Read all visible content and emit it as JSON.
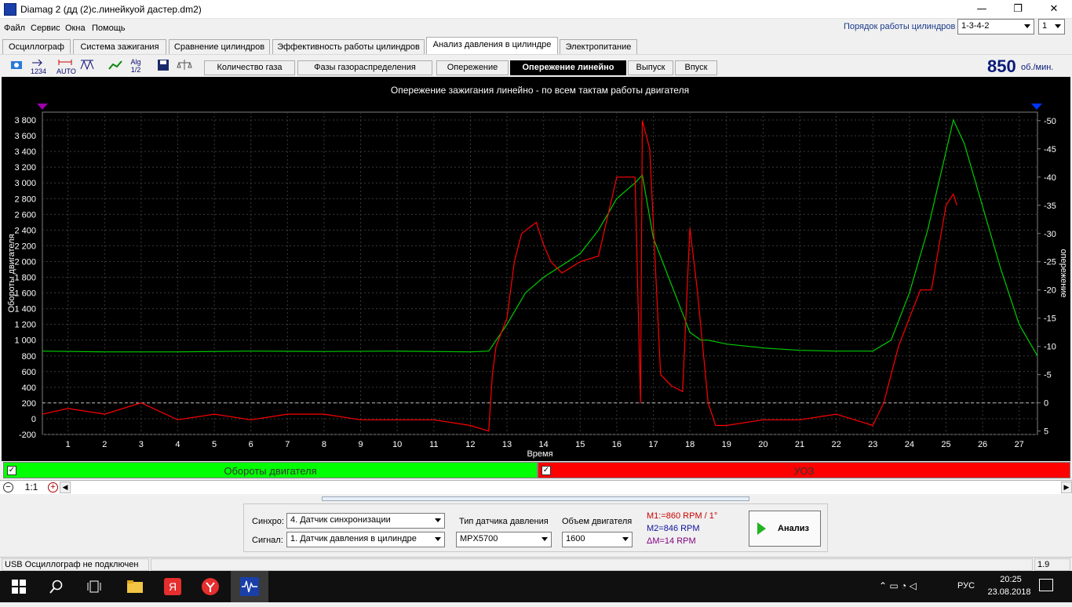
{
  "window": {
    "title": "Diamag 2 (дд (2)с.линейкуой дастер.dm2)",
    "minimize": "—",
    "maximize": "❐",
    "close": "✕"
  },
  "menu": [
    "Файл",
    "Сервис",
    "Окна",
    "Помощь"
  ],
  "cylinder_order": {
    "label": "Порядок работы цилиндров",
    "value": "1-3-4-2",
    "spinner": "1"
  },
  "main_tabs": [
    "Осциллограф",
    "Система зажигания",
    "Сравнение цилиндров",
    "Эффективность работы цилиндров",
    "Анализ давления в цилиндре",
    "Электропитание"
  ],
  "main_tab_active": "Анализ давления в цилиндре",
  "toolbar_icons": [
    "marker-icon",
    "number-icon",
    "auto-icon",
    "scale-icon",
    "graph-icon",
    "algorithm-icon",
    "save-icon",
    "balance-icon"
  ],
  "toolbar_icon_labels": [
    "",
    "1234",
    "AUTO",
    "",
    "",
    "Alg 1/2",
    "",
    ""
  ],
  "sub_tabs": [
    "Количество газа",
    "Фазы газораспределения",
    "Опережение",
    "Опережение линейно",
    "Выпуск",
    "Впуск"
  ],
  "sub_tab_active": "Опережение линейно",
  "rpm": {
    "value": "850",
    "unit": "об./мин."
  },
  "colors": {
    "rpm_series": "#00cc00",
    "advance_series": "#ff0000",
    "chart_bg": "#000000",
    "accent": "#1a3fa8"
  },
  "chart_data": {
    "type": "line",
    "title": "Опережение зажигания линейно - по всем тактам работы двигателя",
    "xlabel": "Время",
    "ylabel": "Обороты двигателя",
    "y2label": "опережение",
    "xlim": [
      0.3,
      27.5
    ],
    "ylim": [
      -200,
      3900
    ],
    "y2lim": [
      -5.6,
      51.5
    ],
    "x_ticks": [
      1,
      2,
      3,
      4,
      5,
      6,
      7,
      8,
      9,
      10,
      11,
      12,
      13,
      14,
      15,
      16,
      17,
      18,
      19,
      20,
      21,
      22,
      23,
      24,
      25,
      26,
      27
    ],
    "y_ticks": [
      "3 800",
      "3 600",
      "3 400",
      "3 200",
      "3 000",
      "2 800",
      "2 600",
      "2 400",
      "2 200",
      "2 000",
      "1 800",
      "1 600",
      "1 400",
      "1 200",
      "1 000",
      "800",
      "600",
      "400",
      "200",
      "0",
      "-200"
    ],
    "y_tick_values": [
      3800,
      3600,
      3400,
      3200,
      3000,
      2800,
      2600,
      2400,
      2200,
      2000,
      1800,
      1600,
      1400,
      1200,
      1000,
      800,
      600,
      400,
      200,
      0,
      -200
    ],
    "y2_ticks": [
      "-50",
      "-45",
      "-40",
      "-35",
      "-30",
      "-25",
      "-20",
      "-15",
      "-10",
      "-5",
      "0",
      "5"
    ],
    "y2_tick_values": [
      50,
      45,
      40,
      35,
      30,
      25,
      20,
      15,
      10,
      5,
      0,
      -5
    ],
    "grid": true,
    "series": [
      {
        "name": "Обороты двигателя",
        "axis": "left",
        "x": [
          0.3,
          2,
          4,
          6,
          8,
          10,
          12,
          12.5,
          13,
          13.5,
          14,
          15,
          15.5,
          16,
          16.5,
          16.7,
          17,
          17.5,
          18,
          18.3,
          18.5,
          19,
          20,
          21,
          22,
          23,
          23.5,
          24,
          24.5,
          25,
          25.2,
          25.5,
          26,
          26.5,
          27,
          27.5
        ],
        "y": [
          860,
          850,
          850,
          860,
          855,
          860,
          850,
          860,
          1200,
          1600,
          1800,
          2100,
          2400,
          2800,
          3000,
          3100,
          2300,
          1700,
          1100,
          1000,
          1000,
          950,
          900,
          870,
          860,
          860,
          1000,
          1600,
          2400,
          3400,
          3800,
          3500,
          2700,
          1900,
          1200,
          800
        ]
      },
      {
        "name": "УОЗ",
        "axis": "right",
        "x": [
          0.3,
          1,
          2,
          3,
          4,
          5,
          6,
          7,
          8,
          9,
          10,
          11,
          12,
          12.5,
          12.6,
          12.7,
          13,
          13.2,
          13.4,
          13.6,
          13.8,
          14,
          14.2,
          14.5,
          15,
          15.5,
          16,
          16.3,
          16.5,
          16.65,
          16.7,
          16.9,
          17.2,
          17.5,
          17.8,
          18,
          18.2,
          18.5,
          18.7,
          19,
          20,
          21,
          22,
          23,
          23.3,
          23.5,
          23.7,
          24,
          24.3,
          24.6,
          25,
          25.2,
          25.3
        ],
        "y": [
          -2,
          -1,
          -2,
          0,
          -3,
          -2,
          -3,
          -2,
          -2,
          -3,
          -3,
          -3,
          -4,
          -5,
          5,
          10,
          15,
          25,
          30,
          31,
          32,
          28,
          25,
          23,
          25,
          26,
          40,
          40,
          40,
          0,
          50,
          45,
          5,
          3,
          2,
          31,
          20,
          0,
          -4,
          -4,
          -3,
          -3,
          -2,
          -4,
          0,
          5,
          10,
          15,
          20,
          20,
          35,
          37,
          35
        ]
      }
    ]
  },
  "legend": {
    "left_label": "Обороты двигателя",
    "right_label": "УОЗ"
  },
  "zoom": {
    "value": "1:1"
  },
  "controls": {
    "sync_label": "Синхро:",
    "sync_value": "4.  Датчик синхронизации",
    "signal_label": "Сигнал:",
    "signal_value": "1.  Датчик давления в цилиндре",
    "sensor_type_label": "Тип датчика давления",
    "sensor_type_value": "MPX5700",
    "volume_label": "Объем двигателя",
    "volume_value": "1600",
    "m1": "M1:=860 RPM / 1°",
    "m2": "M2=846 RPM",
    "dm": "ΔM=14 RPM",
    "analyze_label": "Анализ"
  },
  "status": {
    "left": "USB Осциллограф не подключен",
    "right": "1.9"
  },
  "taskbar": {
    "lang": "РУС",
    "time": "20:25",
    "date": "23.08.2018"
  }
}
